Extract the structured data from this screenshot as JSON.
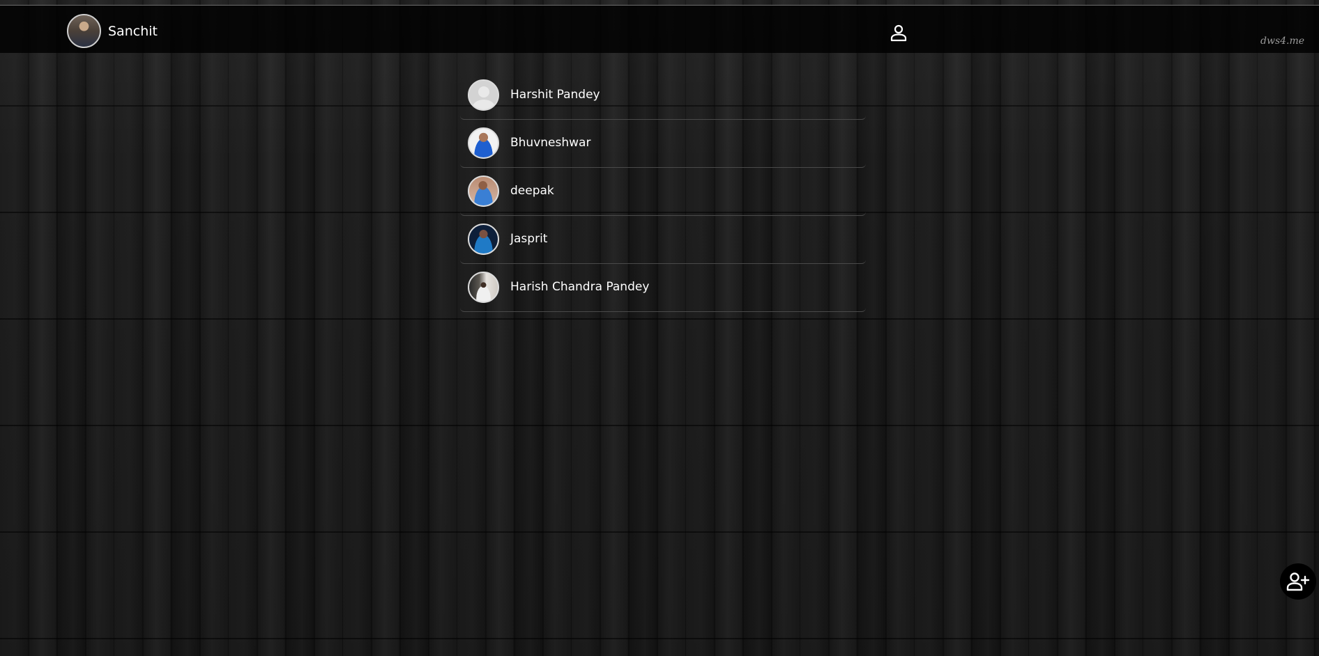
{
  "header": {
    "user_name": "Sanchit",
    "profile_icon": "person-outline-icon",
    "watermark": "dws4.me"
  },
  "contacts": [
    {
      "name": "Harshit Pandey",
      "avatar": "default-avatar"
    },
    {
      "name": "Bhuvneshwar",
      "avatar": "photo"
    },
    {
      "name": "deepak",
      "avatar": "photo"
    },
    {
      "name": "Jasprit",
      "avatar": "photo"
    },
    {
      "name": "Harish Chandra Pandey",
      "avatar": "photo"
    }
  ],
  "fab": {
    "icon": "person-add-icon"
  },
  "colors": {
    "navbar": "#000000",
    "text": "#ffffff",
    "divider": "#4a4a4a"
  }
}
